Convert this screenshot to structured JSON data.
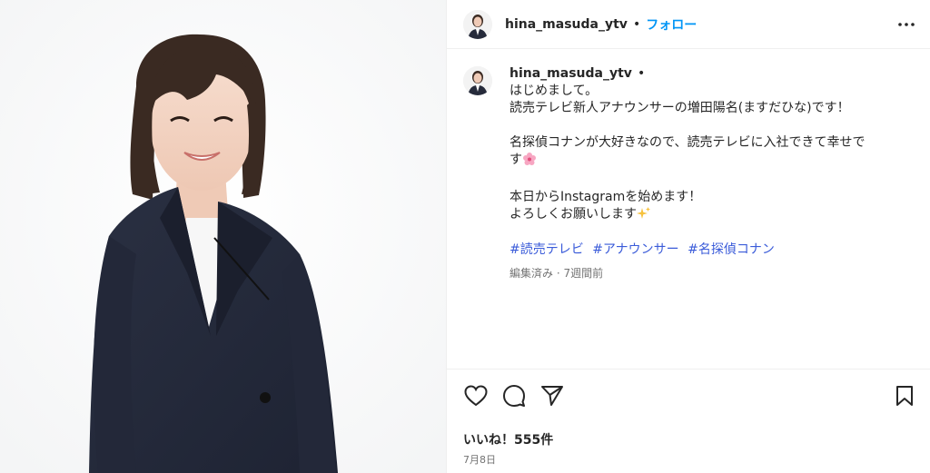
{
  "post": {
    "username": "hina_masuda_ytv",
    "follow_label": "フォロー",
    "separator": "•"
  },
  "caption": {
    "username": "hina_masuda_ytv",
    "separator": "•",
    "lines": [
      "はじめまして。",
      "読売テレビ新人アナウンサーの増田陽名(ますだひな)です！",
      "",
      "名探偵コナンが大好きなので、読売テレビに入社できて幸せで",
      "す",
      "",
      "本日からInstagramを始めます！",
      "よろしくお願いします"
    ],
    "hashtags": [
      "#読売テレビ",
      "#アナウンサー",
      "#名探偵コナン"
    ],
    "meta": "編集済み · 7週間前"
  },
  "actions": {
    "icons": [
      "heart-icon",
      "comment-icon",
      "share-icon",
      "bookmark-icon"
    ],
    "likes": "いいね！555件",
    "date": "7月8日"
  },
  "colors": {
    "follow": "#0095f6",
    "hashtag": "#3a5bd9",
    "suit": "#262b3b",
    "muted": "#737373"
  }
}
